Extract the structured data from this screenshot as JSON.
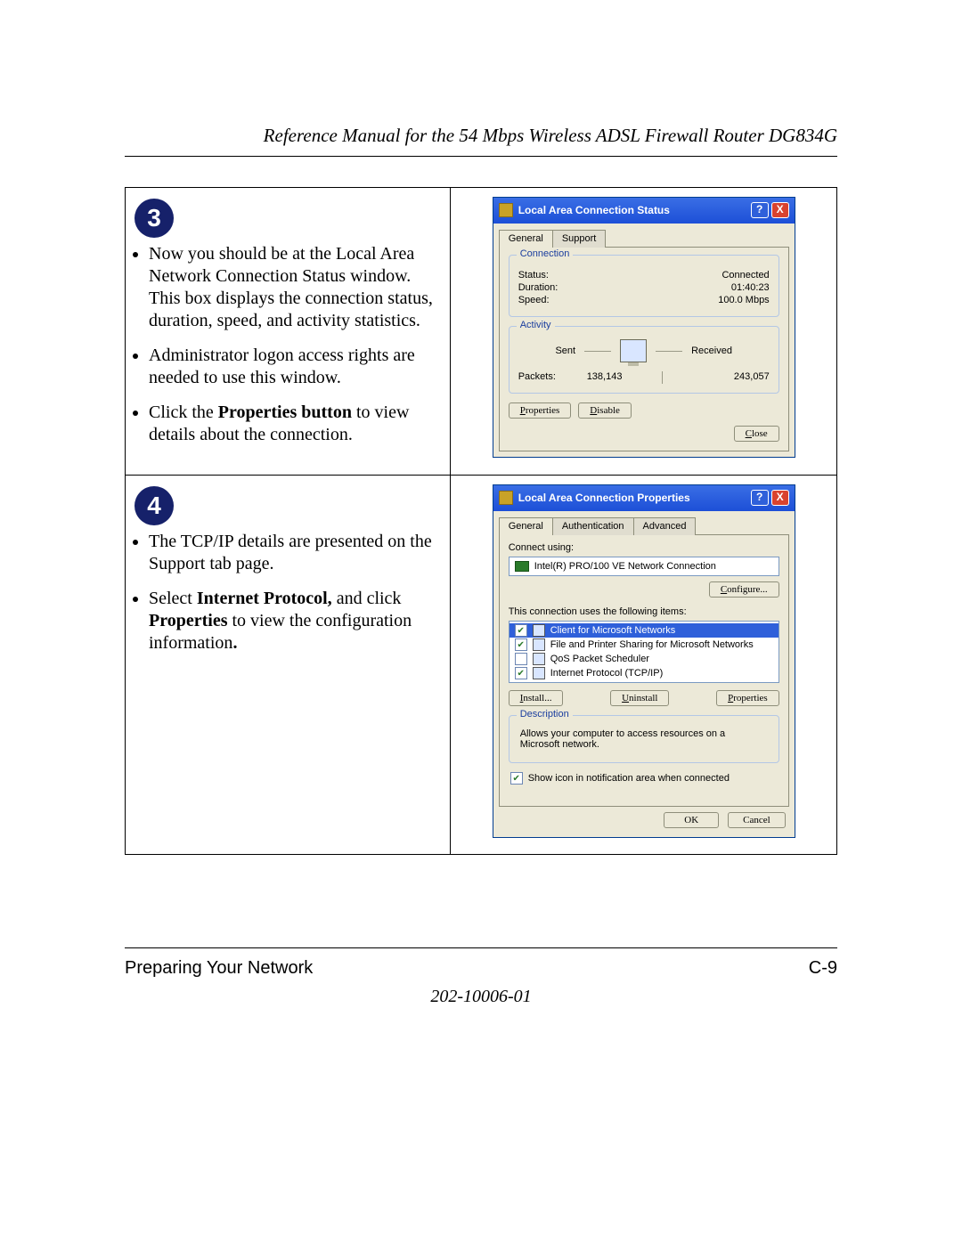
{
  "header": {
    "title": "Reference Manual for the 54 Mbps Wireless ADSL Firewall Router DG834G"
  },
  "steps": {
    "s3": {
      "badge": "3",
      "b1": "Now you should be at the Local Area Network Connection Status window. This box displays the connection status, duration, speed, and activity statistics.",
      "b2": "Administrator logon access rights are needed to use this window.",
      "b3_pre": "Click the ",
      "b3_bold": "Properties button",
      "b3_post": " to view details about the connection."
    },
    "s4": {
      "badge": "4",
      "b1": "The TCP/IP details are presented on the Support tab page.",
      "b2_pre": "Select ",
      "b2_bold1": "Internet Protocol,",
      "b2_mid": " and click ",
      "b2_bold2": "Properties",
      "b2_post": " to view the configuration information",
      "b2_dot": "."
    }
  },
  "dlg1": {
    "title": "Local Area Connection Status",
    "help": "?",
    "close": "X",
    "tabs": {
      "general": "General",
      "support": "Support"
    },
    "group1": {
      "title": "Connection",
      "status_l": "Status:",
      "status_v": "Connected",
      "dur_l": "Duration:",
      "dur_v": "01:40:23",
      "spd_l": "Speed:",
      "spd_v": "100.0 Mbps"
    },
    "group2": {
      "title": "Activity",
      "sent": "Sent",
      "recv": "Received",
      "pk_l": "Packets:",
      "pk_sent": "138,143",
      "pk_recv": "243,057"
    },
    "btn_props": "Properties",
    "btn_props_u": "P",
    "btn_dis": "Disable",
    "btn_dis_u": "D",
    "btn_close": "Close",
    "btn_close_u": "C"
  },
  "dlg2": {
    "title": "Local Area Connection Properties",
    "help": "?",
    "close": "X",
    "tabs": {
      "general": "General",
      "auth": "Authentication",
      "adv": "Advanced"
    },
    "connect_using": "Connect using:",
    "adapter": "Intel(R) PRO/100 VE Network Connection",
    "btn_cfg": "Configure...",
    "btn_cfg_u": "C",
    "items_label": "This connection uses the following items:",
    "items": {
      "i0": "Client for Microsoft Networks",
      "i1": "File and Printer Sharing for Microsoft Networks",
      "i2": "QoS Packet Scheduler",
      "i3": "Internet Protocol (TCP/IP)"
    },
    "btn_inst": "Install...",
    "btn_inst_u": "I",
    "btn_unin": "Uninstall",
    "btn_unin_u": "U",
    "btn_prop": "Properties",
    "btn_prop_u": "P",
    "desc_title": "Description",
    "desc_text": "Allows your computer to access resources on a Microsoft network.",
    "show_icon": "Show icon in notification area when connected",
    "ok": "OK",
    "cancel": "Cancel"
  },
  "footer": {
    "left": "Preparing Your Network",
    "right": "C-9",
    "docnum": "202-10006-01"
  }
}
